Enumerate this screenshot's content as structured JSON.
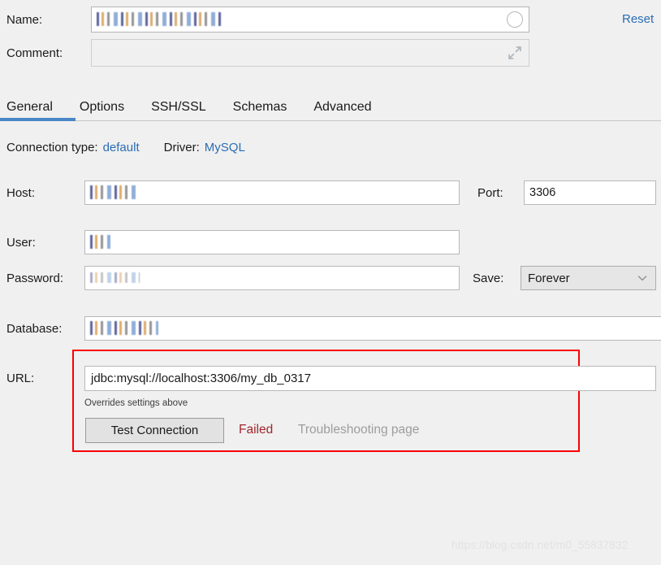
{
  "header": {
    "name_label": "Name:",
    "name_value": "my_db_0317@localhost",
    "name_value_censored": true,
    "comment_label": "Comment:",
    "comment_value": "",
    "reset_label": "Reset",
    "name_circle_icon": "circle-icon",
    "comment_expand_icon": "expand-diagonal-icon"
  },
  "tabs": {
    "items": [
      {
        "label": "General",
        "active": true
      },
      {
        "label": "Options",
        "active": false
      },
      {
        "label": "SSH/SSL",
        "active": false
      },
      {
        "label": "Schemas",
        "active": false
      },
      {
        "label": "Advanced",
        "active": false
      }
    ],
    "active_underline_color": "#4a86c8"
  },
  "connection_meta": {
    "type_label": "Connection type:",
    "type_value": "default",
    "driver_label": "Driver:",
    "driver_value": "MySQL",
    "link_color": "#2a6db5"
  },
  "form": {
    "host_label": "Host:",
    "host_value": "localhost",
    "host_censored": true,
    "port_label": "Port:",
    "port_value": "3306",
    "user_label": "User:",
    "user_value": "root",
    "user_censored": true,
    "password_label": "Password:",
    "password_value": "••••••••••••",
    "password_censored": true,
    "save_label": "Save:",
    "save_value": "Forever",
    "save_chevron_icon": "chevron-down-icon",
    "database_label": "Database:",
    "database_value": "my_db_0317",
    "database_censored": true
  },
  "url_section": {
    "url_label": "URL:",
    "url_value": "jdbc:mysql://localhost:3306/my_db_0317",
    "hint": "Overrides settings above",
    "test_button_label": "Test Connection",
    "test_status": "Failed",
    "test_status_color": "#a1262c",
    "troubleshooting_label": "Troubleshooting page",
    "troubleshooting_color": "#9d9d9d",
    "annotation_box_color": "#fb0000"
  },
  "watermark": {
    "text": "https://blog.csdn.net/m0_55837832"
  }
}
